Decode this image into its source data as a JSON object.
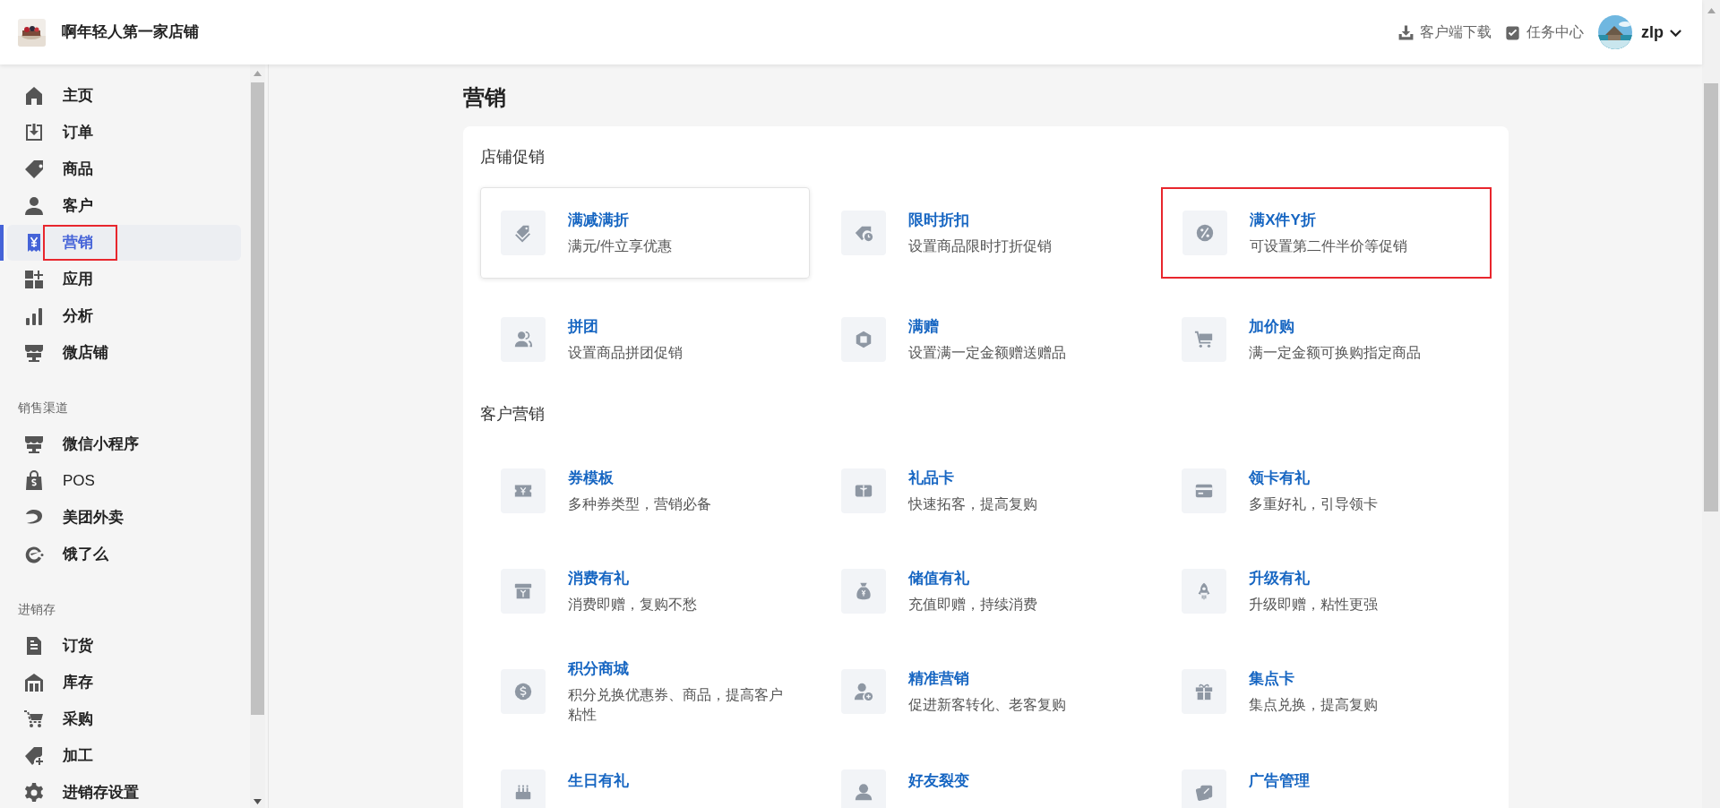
{
  "header": {
    "store_name": "啊年轻人第一家店铺",
    "actions": [
      {
        "label": "客户端下载"
      },
      {
        "label": "任务中心"
      }
    ],
    "user": {
      "name": "zlp"
    }
  },
  "sidebar": {
    "groups": [
      {
        "items": [
          {
            "label": "主页",
            "selected": false,
            "annotated": false
          },
          {
            "label": "订单",
            "selected": false,
            "annotated": false
          },
          {
            "label": "商品",
            "selected": false,
            "annotated": false
          },
          {
            "label": "客户",
            "selected": false,
            "annotated": false
          },
          {
            "label": "营销",
            "selected": true,
            "annotated": true
          },
          {
            "label": "应用",
            "selected": false,
            "annotated": false
          },
          {
            "label": "分析",
            "selected": false,
            "annotated": false
          },
          {
            "label": "微店铺",
            "selected": false,
            "annotated": false
          }
        ]
      },
      {
        "title": "销售渠道",
        "items": [
          {
            "label": "微信小程序",
            "selected": false,
            "annotated": false
          },
          {
            "label": "POS",
            "selected": false,
            "annotated": false
          },
          {
            "label": "美团外卖",
            "selected": false,
            "annotated": false
          },
          {
            "label": "饿了么",
            "selected": false,
            "annotated": false
          }
        ]
      },
      {
        "title": "进销存",
        "items": [
          {
            "label": "订货",
            "selected": false,
            "annotated": false
          },
          {
            "label": "库存",
            "selected": false,
            "annotated": false
          },
          {
            "label": "采购",
            "selected": false,
            "annotated": false
          },
          {
            "label": "加工",
            "selected": false,
            "annotated": false
          },
          {
            "label": "进销存设置",
            "selected": false,
            "annotated": false
          }
        ]
      }
    ]
  },
  "page_title": "营销",
  "sections": [
    {
      "title": "店铺促销",
      "items": [
        {
          "title": "满减满折",
          "description": "满元/件立享优惠",
          "hovered": true,
          "annotated": false
        },
        {
          "title": "限时折扣",
          "description": "设置商品限时打折促销",
          "hovered": false,
          "annotated": false
        },
        {
          "title": "满X件Y折",
          "description": "可设置第二件半价等促销",
          "hovered": false,
          "annotated": true
        },
        {
          "title": "拼团",
          "description": "设置商品拼团促销",
          "hovered": false,
          "annotated": false
        },
        {
          "title": "满赠",
          "description": "设置满一定金额赠送赠品",
          "hovered": false,
          "annotated": false
        },
        {
          "title": "加价购",
          "description": "满一定金额可换购指定商品",
          "hovered": false,
          "annotated": false
        }
      ]
    },
    {
      "title": "客户营销",
      "items": [
        {
          "title": "券模板",
          "description": "多种券类型，营销必备",
          "hovered": false,
          "annotated": false
        },
        {
          "title": "礼品卡",
          "description": "快速拓客，提高复购",
          "hovered": false,
          "annotated": false
        },
        {
          "title": "领卡有礼",
          "description": "多重好礼，引导领卡",
          "hovered": false,
          "annotated": false
        },
        {
          "title": "消费有礼",
          "description": "消费即赠，复购不愁",
          "hovered": false,
          "annotated": false
        },
        {
          "title": "储值有礼",
          "description": "充值即赠，持续消费",
          "hovered": false,
          "annotated": false
        },
        {
          "title": "升级有礼",
          "description": "升级即赠，粘性更强",
          "hovered": false,
          "annotated": false
        },
        {
          "title": "积分商城",
          "description": "积分兑换优惠券、商品，提高客户粘性",
          "hovered": false,
          "annotated": false
        },
        {
          "title": "精准营销",
          "description": "促进新客转化、老客复购",
          "hovered": false,
          "annotated": false
        },
        {
          "title": "集点卡",
          "description": "集点兑换，提高复购",
          "hovered": false,
          "annotated": false
        },
        {
          "title": "生日有礼",
          "hovered": false,
          "annotated": false
        },
        {
          "title": "好友裂变",
          "hovered": false,
          "annotated": false
        },
        {
          "title": "广告管理",
          "hovered": false,
          "annotated": false
        }
      ]
    }
  ]
}
